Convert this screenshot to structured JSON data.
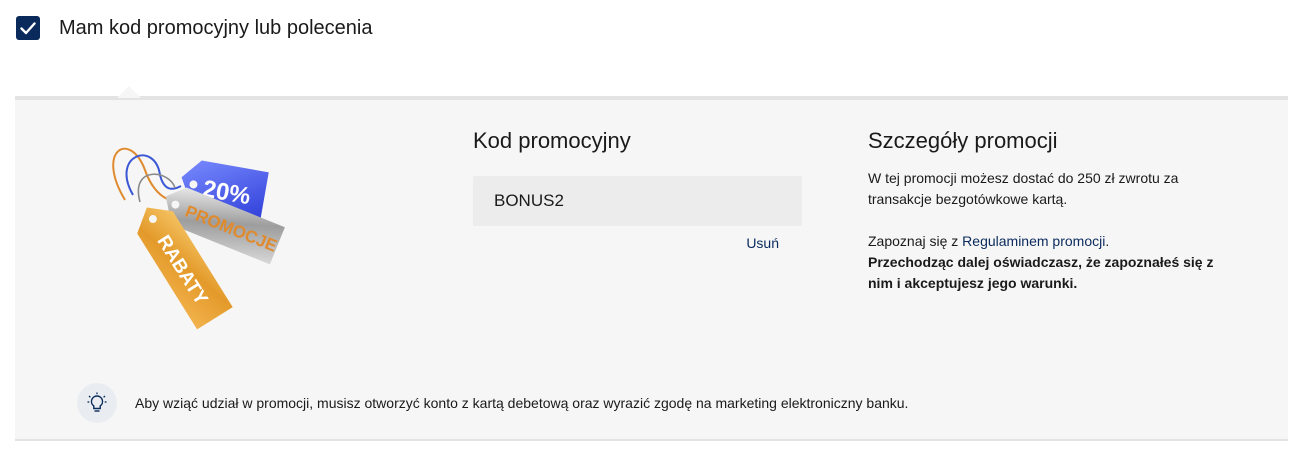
{
  "checkbox": {
    "checked": true,
    "label": "Mam kod promocyjny lub polecenia"
  },
  "illustration": {
    "tag_percent": "20%",
    "tag_promocje": "PROMOCJE",
    "tag_rabaty": "RABATY"
  },
  "promo_code": {
    "title": "Kod promocyjny",
    "value": "BONUS2",
    "remove_label": "Usuń"
  },
  "details": {
    "title": "Szczegóły promocji",
    "description": "W tej promocji możesz dostać do 250 zł zwrotu za transakcje bezgotówkowe kartą.",
    "rules_prefix": "Zapoznaj się z ",
    "rules_link": "Regulaminem promocji",
    "rules_suffix": ".",
    "consent_text": "Przechodząc dalej oświadczasz, że zapoznałeś się z nim i akceptujesz jego warunki."
  },
  "info": {
    "icon": "lightbulb-icon",
    "text": "Aby wziąć udział w promocji, musisz otworzyć konto z kartą debetową oraz wyrazić zgodę na marketing elektroniczny banku."
  },
  "colors": {
    "brand_navy": "#0a2a5c",
    "panel_bg": "#f6f6f6",
    "input_bg": "#ececec"
  }
}
